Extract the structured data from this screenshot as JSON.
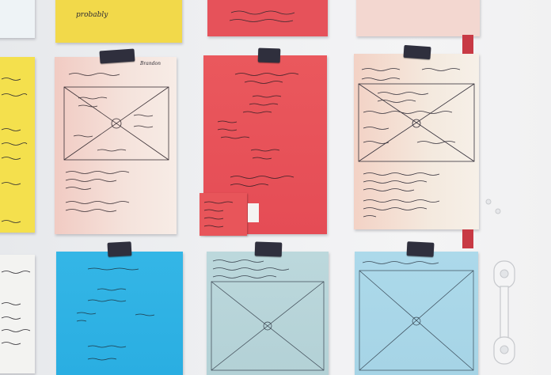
{
  "scene": {
    "description_words": [
      "probably"
    ],
    "colors": {
      "wall": "#eceef0",
      "yellow": "#f2de4c",
      "red": "#e8555a",
      "pink": "#f2cfc6",
      "cream": "#f4ece0",
      "blue": "#2fb2e4",
      "pale_blue": "#b7d6dc",
      "light_blue": "#a8d6e8",
      "tape": "#2f2f3d"
    }
  },
  "cards": {
    "top_yellow_word": "probably",
    "pink_card_name": "Brandon"
  }
}
